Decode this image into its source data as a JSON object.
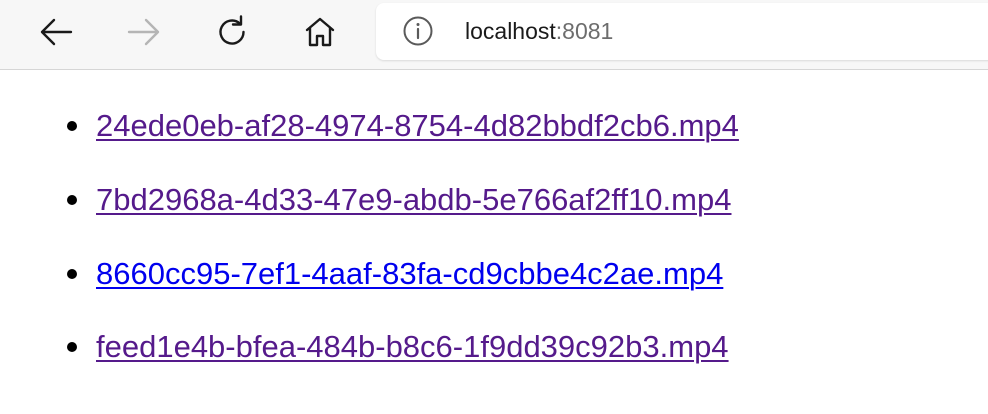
{
  "browser": {
    "nav": {
      "back_icon": "arrow-left-icon",
      "forward_icon": "arrow-right-icon",
      "refresh_icon": "refresh-icon",
      "home_icon": "home-icon",
      "forward_disabled": true
    },
    "address_bar": {
      "info_icon": "info-circle-icon",
      "host": "localhost",
      "port": ":8081"
    }
  },
  "page": {
    "files": [
      {
        "name": "24ede0eb-af28-4974-8754-4d82bbdf2cb6.mp4",
        "state": "visited"
      },
      {
        "name": "7bd2968a-4d33-47e9-abdb-5e766af2ff10.mp4",
        "state": "visited"
      },
      {
        "name": "8660cc95-7ef1-4aaf-83fa-cd9cbbe4c2ae.mp4",
        "state": "unvisited"
      },
      {
        "name": "feed1e4b-bfea-484b-b8c6-1f9dd39c92b3.mp4",
        "state": "visited"
      }
    ]
  },
  "colors": {
    "visited_link": "#551a8b",
    "unvisited_link": "#0000ee",
    "toolbar_bg": "#f7f7f7",
    "icon": "#1a1a1a",
    "icon_disabled": "#b5b5b5"
  }
}
